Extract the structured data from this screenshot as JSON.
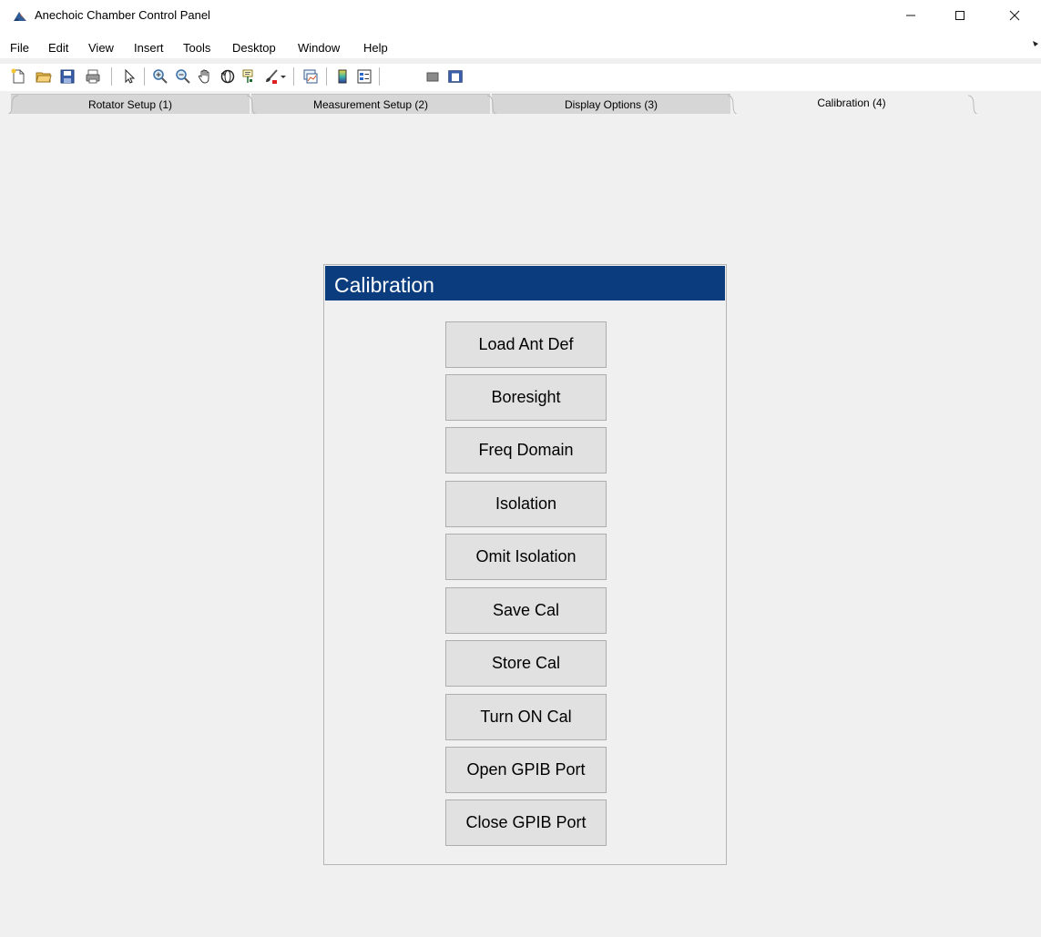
{
  "window": {
    "title": "Anechoic Chamber Control Panel",
    "icon": "matlab-logo-icon",
    "controls": {
      "minimize": "─",
      "maximize": "☐",
      "close": "✕"
    }
  },
  "menubar": {
    "items": [
      "File",
      "Edit",
      "View",
      "Insert",
      "Tools",
      "Desktop",
      "Window",
      "Help"
    ]
  },
  "toolbar": {
    "icons": [
      "new-figure-icon",
      "open-file-icon",
      "save-icon",
      "print-icon",
      "pointer-icon",
      "zoom-in-icon",
      "zoom-out-icon",
      "pan-hand-icon",
      "rotate-3d-icon",
      "data-cursor-icon",
      "brush-icon",
      "link-plot-icon",
      "colorbar-icon",
      "legend-icon",
      "hide-plot-tools-icon",
      "show-plot-tools-icon"
    ]
  },
  "tabs": [
    {
      "label": "Rotator Setup (1)",
      "active": false
    },
    {
      "label": "Measurement Setup (2)",
      "active": false
    },
    {
      "label": "Display Options (3)",
      "active": false
    },
    {
      "label": "Calibration (4)",
      "active": true
    }
  ],
  "panel": {
    "title": "Calibration",
    "header_color": "#0b3d7e",
    "buttons": [
      "Load Ant Def",
      "Boresight",
      "Freq Domain",
      "Isolation",
      "Omit Isolation",
      "Save Cal",
      "Store Cal",
      "Turn ON Cal",
      "Open GPIB Port",
      "Close GPIB Port"
    ]
  }
}
